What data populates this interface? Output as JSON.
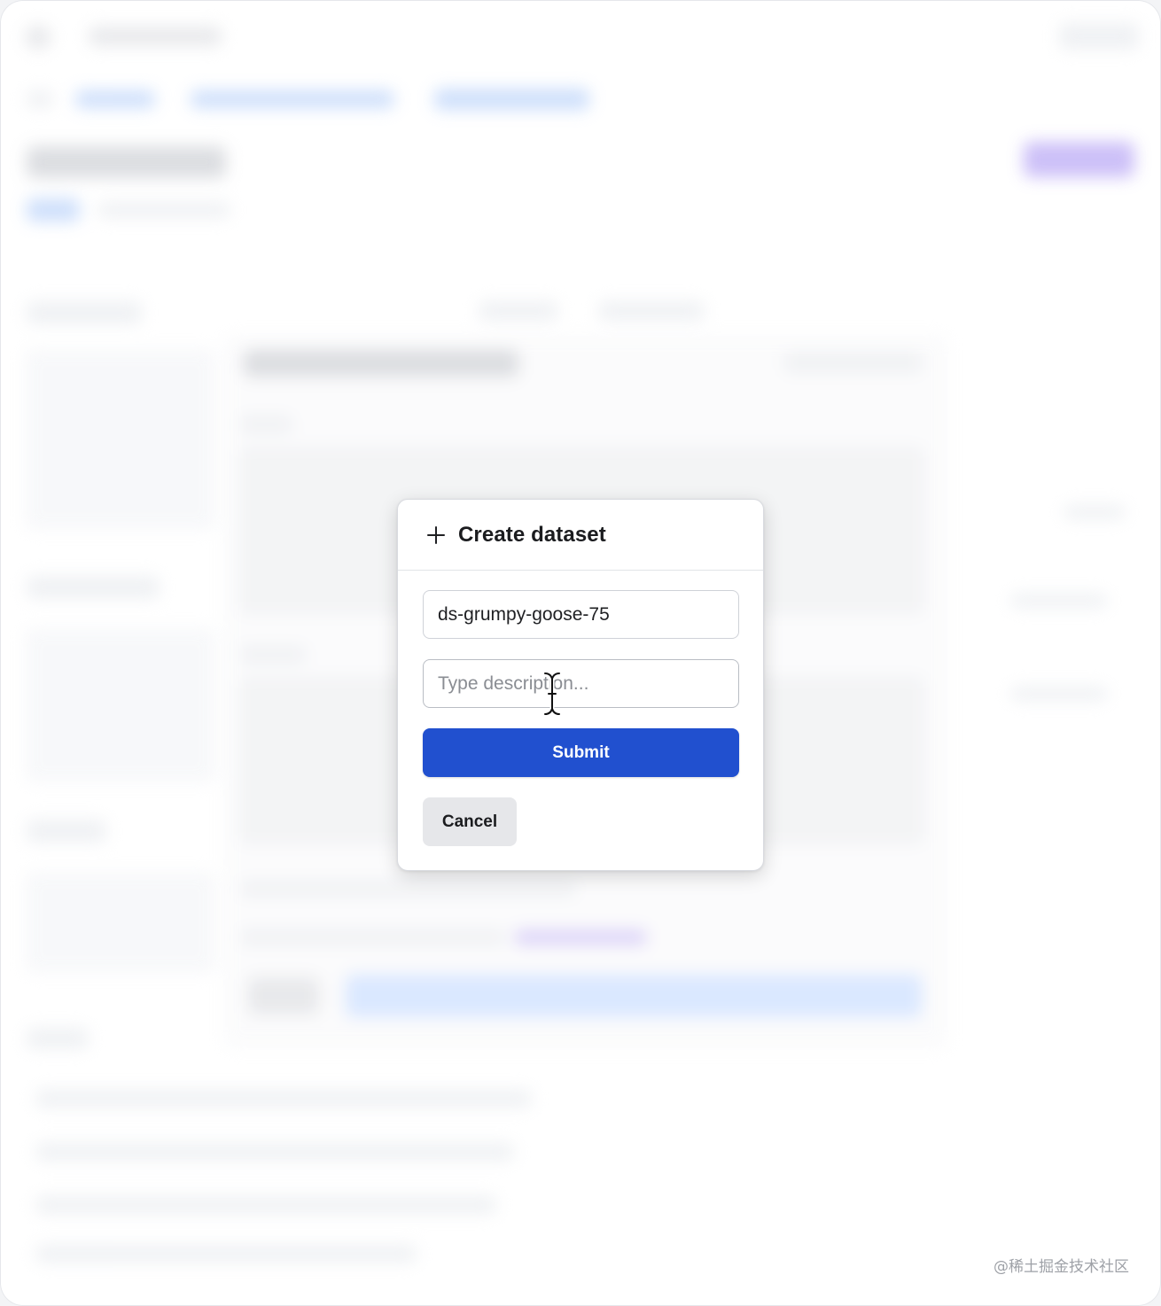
{
  "modal": {
    "title": "Create dataset",
    "title_icon": "plus-icon",
    "name_value": "ds-grumpy-goose-75",
    "description_placeholder": "Type description...",
    "submit_label": "Submit",
    "cancel_label": "Cancel"
  },
  "cursor": {
    "icon": "text-cursor-icon"
  },
  "watermark": {
    "text": "@稀土掘金技术社区"
  },
  "colors": {
    "primary": "#2150cf",
    "cancel_bg": "#e6e7ea",
    "accent_purple": "#c7b9f7"
  }
}
